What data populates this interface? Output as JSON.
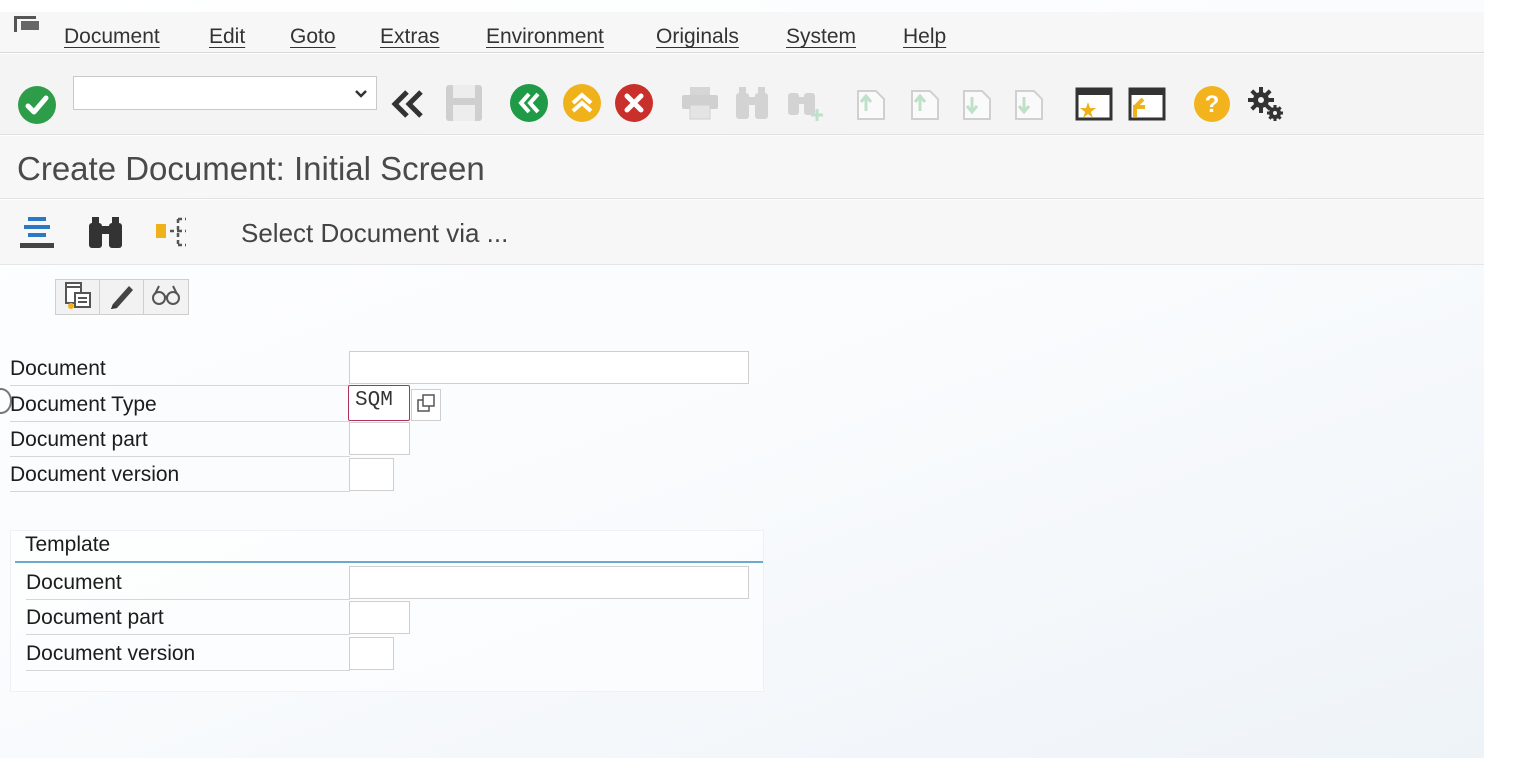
{
  "menubar": {
    "items": [
      "Document",
      "Edit",
      "Goto",
      "Extras",
      "Environment",
      "Originals",
      "System",
      "Help"
    ]
  },
  "toolbar": {
    "command_value": "",
    "icons": [
      "enter-icon",
      "command-dropdown-icon",
      "back-double-icon",
      "save-icon",
      "back-icon",
      "exit-icon",
      "cancel-icon",
      "print-icon",
      "find-icon",
      "find-next-icon",
      "first-page-icon",
      "previous-page-icon",
      "next-page-icon",
      "last-page-icon",
      "create-session-icon",
      "generate-shortcut-icon",
      "help-icon",
      "customize-layout-icon"
    ]
  },
  "title": "Create Document: Initial Screen",
  "app_toolbar": {
    "icons": [
      "list-icon",
      "find-icon",
      "structure-icon"
    ],
    "select_label": "Select Document via ..."
  },
  "button_group": {
    "icons": [
      "create-icon",
      "change-icon",
      "display-icon"
    ]
  },
  "form": {
    "document_label": "Document",
    "document_value": "",
    "document_type_label": "Document Type",
    "document_type_value": "SQM",
    "document_part_label": "Document part",
    "document_part_value": "",
    "document_version_label": "Document version",
    "document_version_value": ""
  },
  "template": {
    "title": "Template",
    "document_label": "Document",
    "document_value": "",
    "document_part_label": "Document part",
    "document_part_value": "",
    "document_version_label": "Document version",
    "document_version_value": ""
  },
  "colors": {
    "enter_green": "#2e9d4a",
    "back_green": "#1f9a46",
    "exit_yellow": "#f0b21a",
    "cancel_red": "#c9302c",
    "help_yellow": "#f2b31c",
    "group_line": "#6fa9c8",
    "focus_border": "#b0325a"
  }
}
